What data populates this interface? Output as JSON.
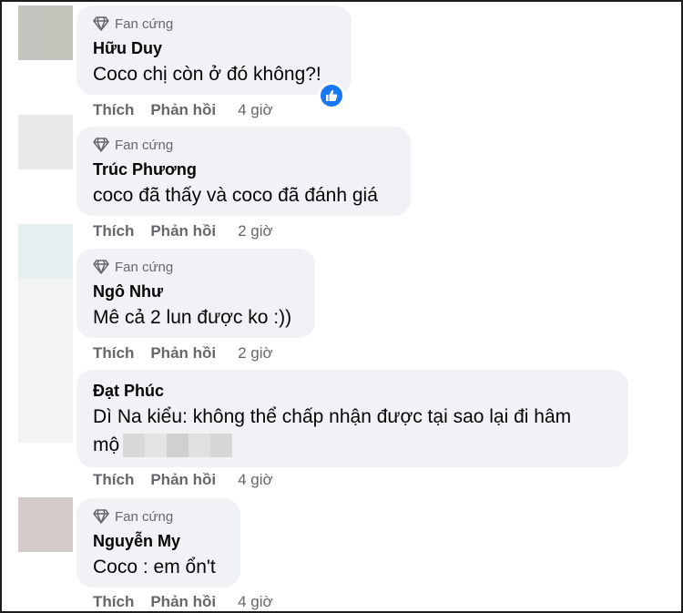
{
  "comments": [
    {
      "badge": "Fan cứng",
      "name": "Hữu Duy",
      "text": "Coco chị còn ở đó không?!",
      "like_label": "Thích",
      "reply_label": "Phản hồi",
      "time": "4 giờ",
      "avatar_color": "#c4c4bc"
    },
    {
      "badge": "Fan cứng",
      "name": "Trúc Phương",
      "text": "coco đã thấy và coco đã đánh giá",
      "like_label": "Thích",
      "reply_label": "Phản hồi",
      "time": "2 giờ",
      "avatar_color": "#e8e8ea"
    },
    {
      "badge": "Fan cứng",
      "name": "Ngô Như",
      "text": "Mê cả 2 lun được ko :))",
      "like_label": "Thích",
      "reply_label": "Phản hồi",
      "time": "2 giờ",
      "avatar_color": "#e6f0f0"
    },
    {
      "name": "Đạt Phúc",
      "text_line1": "Dì Na kiểu: không thể chấp nhận được tại sao lại đi hâm",
      "text_line2": "mộ",
      "like_label": "Thích",
      "reply_label": "Phản hồi",
      "time": "4 giờ"
    },
    {
      "badge": "Fan cứng",
      "name": "Nguyễn My",
      "text": "Coco : em ổn't",
      "like_label": "Thích",
      "reply_label": "Phản hồi",
      "time": "4 giờ",
      "avatar_color": "#d6cccc"
    }
  ],
  "colors": {
    "bubble": "#f0f2f5",
    "secondary_text": "#65676b",
    "like_blue": "#1877f2"
  },
  "icons": {
    "badge": "diamond-icon",
    "reaction": "thumbs-up-icon"
  }
}
